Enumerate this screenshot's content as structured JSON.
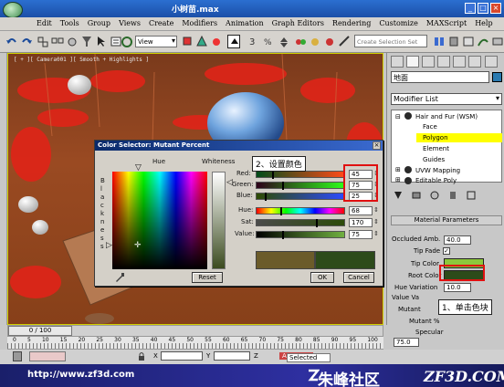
{
  "titlebar": {
    "title": "小树苗.max"
  },
  "menubar": {
    "items": [
      "Edit",
      "Tools",
      "Group",
      "Views",
      "Create",
      "Modifiers",
      "Animation",
      "Graph Editors",
      "Rendering",
      "Customize",
      "MAXScript",
      "Help"
    ]
  },
  "toolbar": {
    "view_dropdown": "View",
    "selection_set": "Create Selection Set"
  },
  "viewport": {
    "label": "[ + ][ Camera001 ][ Smooth + Highlights ]"
  },
  "color_selector": {
    "title": "Color Selector: Mutant Percent",
    "hue_label": "Hue",
    "whiteness_label": "Whiteness",
    "blackness_label": "Blackness",
    "channels": [
      {
        "label": "Red:",
        "value": "45"
      },
      {
        "label": "Green:",
        "value": "75"
      },
      {
        "label": "Blue:",
        "value": "25"
      },
      {
        "label": "Hue:",
        "value": "68"
      },
      {
        "label": "Sat:",
        "value": "170"
      },
      {
        "label": "Value:",
        "value": "75"
      }
    ],
    "reset_label": "Reset",
    "ok_label": "OK",
    "cancel_label": "Cancel"
  },
  "callouts": {
    "step1": "1、单击色块",
    "step2": "2、设置颜色"
  },
  "command_panel": {
    "object_name": "地面",
    "modifier_list": "Modifier List",
    "stack": {
      "hair_fur": "Hair and Fur (WSM)",
      "face": "Face",
      "polygon": "Polygon",
      "element": "Element",
      "guides": "Guides",
      "uvw": "UVW Mapping",
      "editable_poly": "Editable Poly"
    },
    "material_params": {
      "header": "Material Parameters",
      "occluded_amb_label": "Occluded Amb.",
      "occluded_amb_value": "40.0",
      "tip_fade_label": "Tip Fade",
      "tip_color_label": "Tip Color",
      "root_color_label": "Root Color",
      "hue_variation_label": "Hue Variation",
      "hue_variation_value": "10.0",
      "value_variation_label": "Value Va",
      "mutant_color_label": "Mutant",
      "mutant_percent_label": "Mutant %",
      "specular_label": "Specular",
      "specular_value": "75.0"
    }
  },
  "timeline": {
    "frame_label": "0 / 100",
    "ticks": [
      "0",
      "5",
      "10",
      "15",
      "20",
      "25",
      "30",
      "35",
      "40",
      "45",
      "50",
      "55",
      "60",
      "65",
      "70",
      "75",
      "80",
      "85",
      "90",
      "95",
      "100"
    ]
  },
  "status": {
    "coord_x_label": "X",
    "coord_y_label": "Y",
    "coord_z_label": "Z",
    "auto_key": "Auto Key",
    "selected": "Selected"
  },
  "branding": {
    "url": "http://www.zf3d.com",
    "name_cn": "朱峰社区",
    "name_en": "ZF3D.COM"
  },
  "colors": {
    "tip_color": "#8cc83c",
    "root_color": "#2d4b1a",
    "old_color": "#6b5b2a",
    "highlight": "#ffff00",
    "callout_border": "#e01010"
  }
}
